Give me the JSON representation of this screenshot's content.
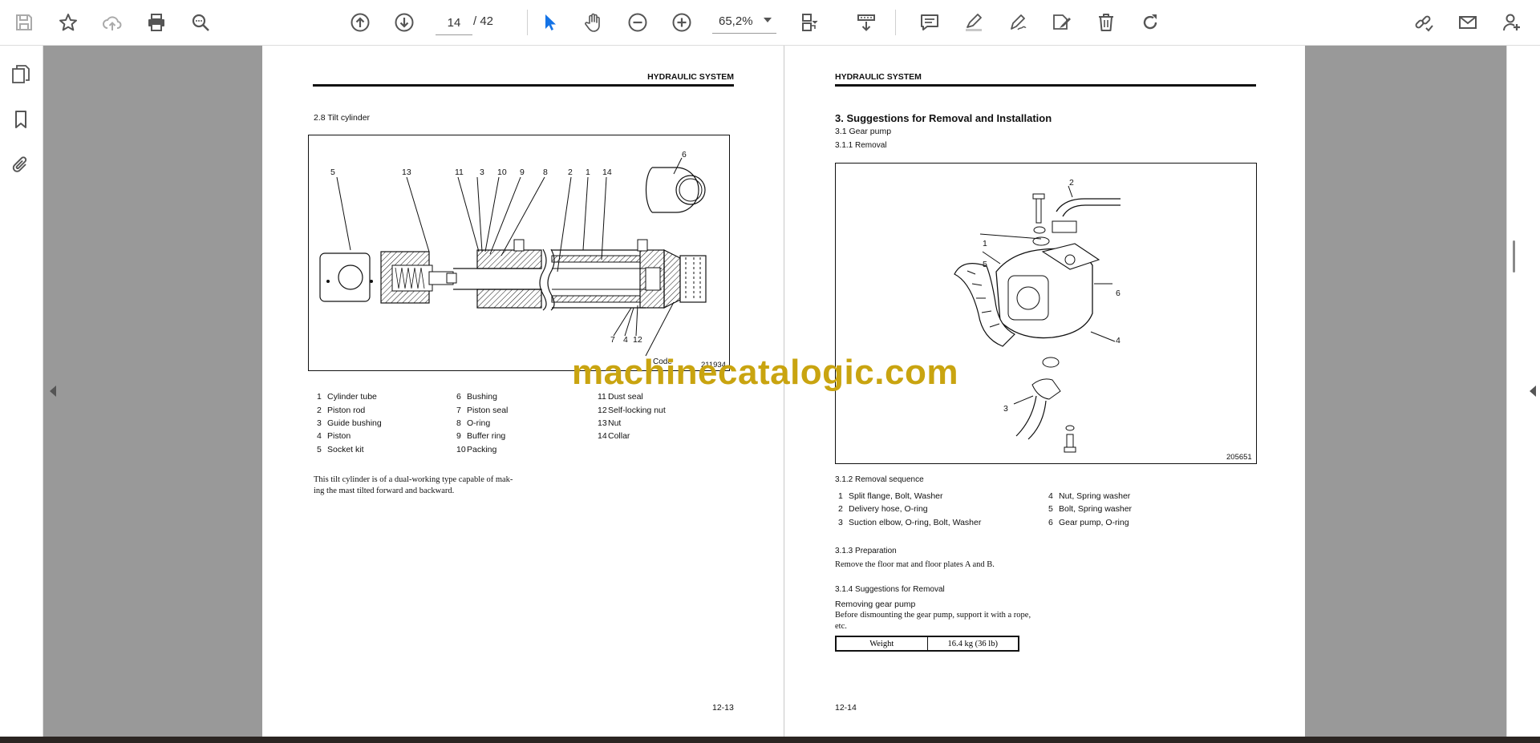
{
  "toolbar": {
    "current_page": "14",
    "total_pages": "/ 42",
    "zoom": "65,2%"
  },
  "colors": {
    "accent": "#1473e6",
    "viewer_gray": "#999999",
    "watermark": "#c9a410"
  },
  "watermark": "machinecatalogic.com",
  "page_left": {
    "header": "HYDRAULIC SYSTEM",
    "section": "2.8   Tilt cylinder",
    "figure_code": "211934",
    "code_label": "Code",
    "callouts": {
      "c5": "5",
      "c13": "13",
      "c11": "11",
      "c3": "3",
      "c10": "10",
      "c9": "9",
      "c8": "8",
      "c2": "2",
      "c1": "1",
      "c14": "14",
      "c6": "6",
      "c7": "7",
      "c4": "4",
      "c12": "12"
    },
    "parts": [
      {
        "n": "1",
        "t": "Cylinder tube"
      },
      {
        "n": "2",
        "t": "Piston rod"
      },
      {
        "n": "3",
        "t": "Guide bushing"
      },
      {
        "n": "4",
        "t": "Piston"
      },
      {
        "n": "5",
        "t": "Socket kit"
      },
      {
        "n": "6",
        "t": "Bushing"
      },
      {
        "n": "7",
        "t": "Piston seal"
      },
      {
        "n": "8",
        "t": "O-ring"
      },
      {
        "n": "9",
        "t": "Buffer ring"
      },
      {
        "n": "10",
        "t": "Packing"
      },
      {
        "n": "11",
        "t": "Dust seal"
      },
      {
        "n": "12",
        "t": "Self-locking nut"
      },
      {
        "n": "13",
        "t": "Nut"
      },
      {
        "n": "14",
        "t": "Collar"
      }
    ],
    "description_line1": "This tilt cylinder is of a dual-working type capable of mak-",
    "description_line2": "ing the mast tilted forward and backward.",
    "page_number": "12-13"
  },
  "page_right": {
    "header": "HYDRAULIC SYSTEM",
    "title": "3. Suggestions for Removal and Installation",
    "sub1": "3.1    Gear pump",
    "sub2": "3.1.1   Removal",
    "figure_code": "205651",
    "callouts": {
      "c2": "2",
      "c1": "1",
      "c5": "5",
      "c6": "6",
      "c4": "4",
      "c3": "3"
    },
    "seq_title": "3.1.2   Removal sequence",
    "sequence": [
      {
        "n": "1",
        "t": "Split flange, Bolt, Washer"
      },
      {
        "n": "2",
        "t": "Delivery hose, O-ring"
      },
      {
        "n": "3",
        "t": "Suction elbow, O-ring, Bolt, Washer"
      },
      {
        "n": "4",
        "t": "Nut, Spring washer"
      },
      {
        "n": "5",
        "t": "Bolt, Spring washer"
      },
      {
        "n": "6",
        "t": "Gear pump, O-ring"
      }
    ],
    "prep_title": "3.1.3   Preparation",
    "prep_text": "Remove the floor mat and floor plates A and B.",
    "sugg_title": "3.1.4   Suggestions for Removal",
    "sugg_sub": "Removing gear pump",
    "sugg_text1": "Before dismounting the gear pump, support it with a rope,",
    "sugg_text2": "etc.",
    "weight_label": "Weight",
    "weight_value": "16.4 kg (36 lb)",
    "page_number": "12-14"
  }
}
